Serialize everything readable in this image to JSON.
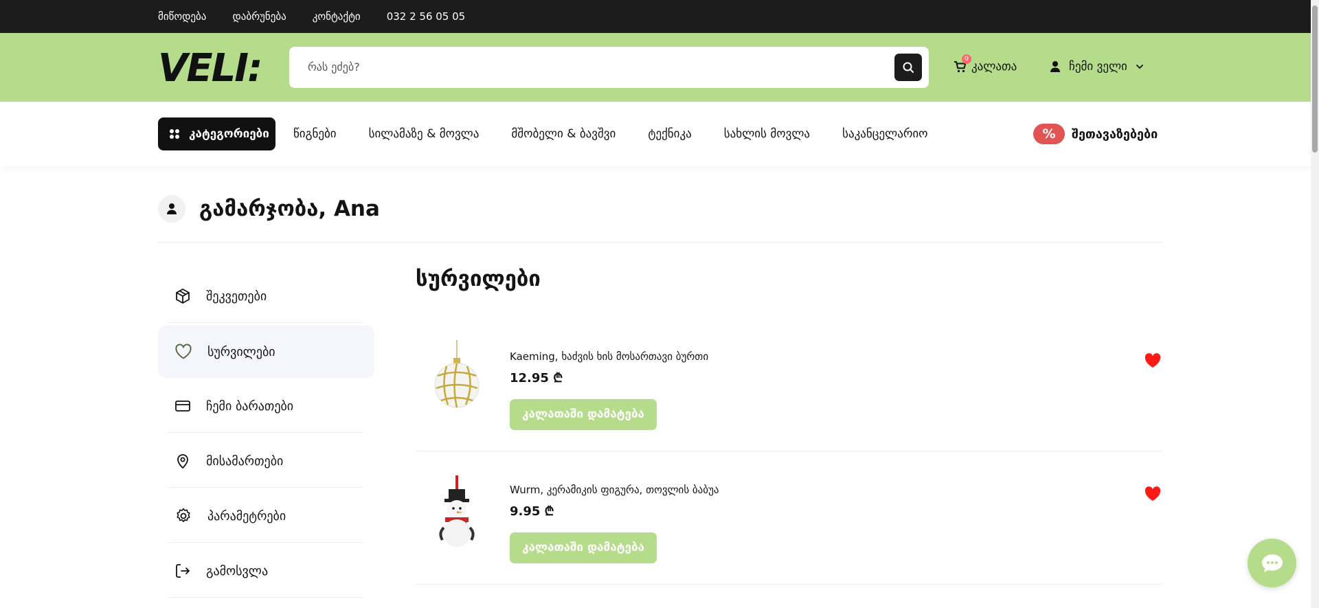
{
  "topbar": {
    "links": [
      "მიწოდება",
      "დაბრუნება",
      "კონტაქტი",
      "032 2 56 05 05"
    ]
  },
  "header": {
    "logo": "VELI:",
    "search_placeholder": "რას ეძებ?",
    "cart_label": "კალათა",
    "cart_count": "0",
    "account_label": "ჩემი ველი"
  },
  "nav": {
    "categories_label": "კატეგორიები",
    "links": [
      "წიგნები",
      "სილამაზე & მოვლა",
      "მშობელი & ბავშვი",
      "ტექნიკა",
      "სახლის მოვლა",
      "საკანცელარიო"
    ],
    "offers_badge": "%",
    "offers_label": "შეთავაზებები"
  },
  "account": {
    "greeting": "გამარჯობა, Ana"
  },
  "sidebar": {
    "items": [
      {
        "label": "შეკვეთები",
        "icon": "package-icon"
      },
      {
        "label": "სურვილები",
        "icon": "heart-outline-icon"
      },
      {
        "label": "ჩემი ბარათები",
        "icon": "credit-card-icon"
      },
      {
        "label": "მისამართები",
        "icon": "map-pin-icon"
      },
      {
        "label": "პარამეტრები",
        "icon": "gear-icon"
      },
      {
        "label": "გამოსვლა",
        "icon": "logout-icon"
      }
    ],
    "active_index": 1
  },
  "wishlist": {
    "title": "სურვილები",
    "add_to_cart_label": "კალათაში დამატება",
    "products": [
      {
        "name": "Kaeming, ხაძვის ხის მოსართავი ბურთი",
        "price": "12.95 ₾",
        "image": "ornament-ball-image"
      },
      {
        "name": "Wurm, კერამიკის ფიგურა, თოვლის ბაბუა",
        "price": "9.95 ₾",
        "image": "snowman-figure-image"
      }
    ]
  },
  "colors": {
    "brand_green": "#b5dc8a",
    "dark": "#1c1c1c",
    "offer_red": "#e25353",
    "heart_red": "#ff1a1a"
  }
}
